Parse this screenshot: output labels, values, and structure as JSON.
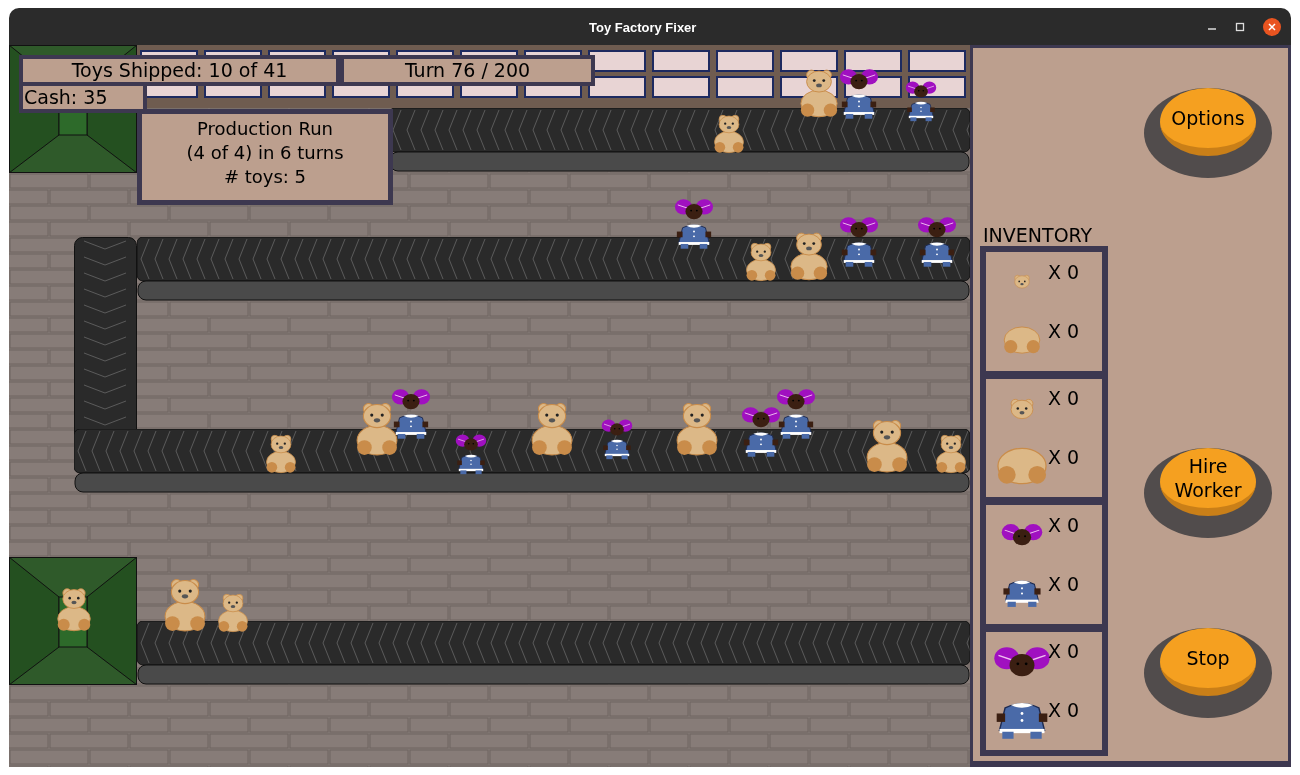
{
  "window": {
    "title": "Toy Factory Fixer"
  },
  "hud": {
    "toys_shipped": "Toys Shipped: 10 of 41",
    "turn": "Turn 76 / 200",
    "cash": "Cash: 35"
  },
  "production_run": {
    "title": "Production Run",
    "progress": "(4 of 4) in 6 turns",
    "toys": "# toys: 5"
  },
  "inventory": {
    "title": "INVENTORY",
    "groups": [
      {
        "items": [
          {
            "kind": "bear-head-small",
            "count": "X 0"
          },
          {
            "kind": "bear-body-small",
            "count": "X 0"
          }
        ]
      },
      {
        "items": [
          {
            "kind": "bear-head",
            "count": "X 0"
          },
          {
            "kind": "bear-body",
            "count": "X 0"
          }
        ]
      },
      {
        "items": [
          {
            "kind": "doll-head-small",
            "count": "X 0"
          },
          {
            "kind": "doll-body-small",
            "count": "X 0"
          }
        ]
      },
      {
        "items": [
          {
            "kind": "doll-head",
            "count": "X 0"
          },
          {
            "kind": "doll-body",
            "count": "X 0"
          }
        ]
      }
    ]
  },
  "buttons": [
    "Options",
    "Hire Worker",
    "Stop"
  ]
}
